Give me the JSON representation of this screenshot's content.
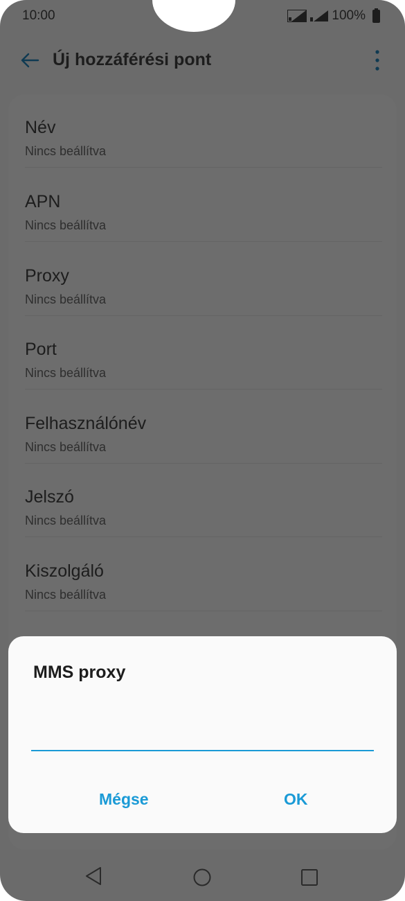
{
  "status_bar": {
    "time": "10:00",
    "battery": "100%"
  },
  "header": {
    "title": "Új hozzáférési pont",
    "back_icon": "arrow-left-icon",
    "more_icon": "more-vertical-icon"
  },
  "settings": {
    "items": [
      {
        "title": "Név",
        "value": "Nincs beállítva"
      },
      {
        "title": "APN",
        "value": "Nincs beállítva"
      },
      {
        "title": "Proxy",
        "value": "Nincs beállítva"
      },
      {
        "title": "Port",
        "value": "Nincs beállítva"
      },
      {
        "title": "Felhasználónév",
        "value": "Nincs beállítva"
      },
      {
        "title": "Jelszó",
        "value": "Nincs beállítva"
      },
      {
        "title": "Kiszolgáló",
        "value": "Nincs beállítva"
      }
    ]
  },
  "dialog": {
    "title": "MMS proxy",
    "input_value": "",
    "cancel_label": "Mégse",
    "ok_label": "OK"
  },
  "colors": {
    "accent": "#1a9ad6",
    "scrim_background": "#6b6b6b",
    "dialog_background": "#fafafa"
  }
}
